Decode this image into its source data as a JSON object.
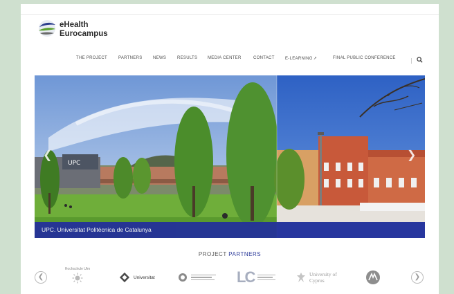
{
  "brand": {
    "line1": "eHealth",
    "line2": "Eurocampus"
  },
  "nav": {
    "items": [
      {
        "label": "THE PROJECT"
      },
      {
        "label": "PARTNERS"
      },
      {
        "label": "NEWS"
      },
      {
        "label": "RESULTS"
      },
      {
        "label": "MEDIA CENTER"
      },
      {
        "label": "CONTACT"
      },
      {
        "label": "E-LEARNING"
      },
      {
        "label": "FINAL PUBLIC CONFERENCE"
      }
    ],
    "search_icon": "search-icon"
  },
  "hero": {
    "caption": "UPC. Universitat Politècnica de Catalunya",
    "building_sign": "UPC",
    "prev_icon": "chevron-left-icon",
    "next_icon": "chevron-right-icon"
  },
  "partners": {
    "title_part1": "PROJECT ",
    "title_part2": "PARTNERS",
    "logos": [
      {
        "label": "Hochschule Ulm"
      },
      {
        "label": "Universitat"
      },
      {
        "label": ""
      },
      {
        "label": "LC"
      },
      {
        "label": "University of Cyprus"
      },
      {
        "label": ""
      }
    ]
  },
  "colors": {
    "accent": "#24309a",
    "page_bg": "#cfe0cf"
  }
}
